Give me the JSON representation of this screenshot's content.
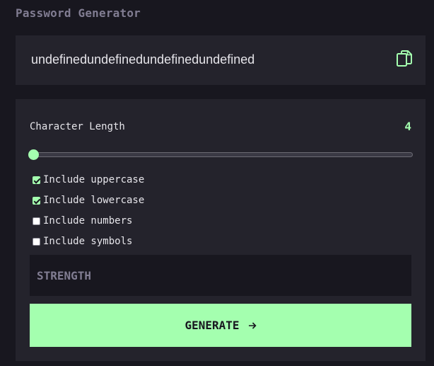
{
  "app": {
    "title": "Password Generator"
  },
  "output": {
    "password": "undefinedundefinedundefinedundefined",
    "copy_icon": "copy-icon"
  },
  "settings": {
    "length_label": "Character Length",
    "length_value": "4",
    "slider": {
      "value": 4,
      "fill_fraction": 0
    },
    "options": [
      {
        "label": "Include uppercase",
        "checked": true
      },
      {
        "label": "Include lowercase",
        "checked": true
      },
      {
        "label": "Include numbers",
        "checked": false
      },
      {
        "label": "Include symbols",
        "checked": false
      }
    ],
    "strength_label": "STRENGTH",
    "generate_label": "GENERATE",
    "generate_icon": "arrow-right-icon"
  },
  "colors": {
    "background": "#18171f",
    "panel": "#24232c",
    "accent": "#a4ffaf",
    "muted_text": "#817d92",
    "text": "#e6e5ea"
  }
}
